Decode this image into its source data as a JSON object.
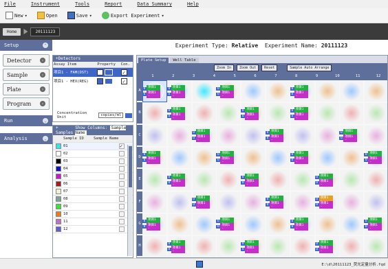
{
  "menu": [
    "File",
    "Instrument",
    "Tools",
    "Report",
    "Data Summary",
    "Help"
  ],
  "toolbar": {
    "new": "New",
    "open": "Open",
    "save": "Save",
    "export": "Export Experiment"
  },
  "breadcrumb": {
    "home": "Home",
    "experiment": "20111123"
  },
  "nav": {
    "setup": "Setup",
    "run": "Run",
    "analysis": "Analysis",
    "setup_items": [
      "Detector",
      "Sample",
      "Plate",
      "Program"
    ]
  },
  "experiment": {
    "label": "Experiment Type:",
    "type": "Relative",
    "name_label": "Experiment Name:",
    "name": "20111123"
  },
  "detectors": {
    "title": "Detectors",
    "headers": [
      "Assay Item",
      "Property",
      "Con."
    ],
    "rows": [
      {
        "item": "项目1 - FAM(DST)",
        "checked": true,
        "selected": true
      },
      {
        "item": "项目1 - HEX(REG)",
        "checked": true,
        "selected": false
      }
    ],
    "conc_label": "Concentration Unit",
    "conc_value": "copies/ml"
  },
  "samples": {
    "title": "Samples",
    "show_cols": "Show Columns:",
    "show_value": "Sample Name",
    "headers": [
      "Sample ID",
      "Sample Name"
    ],
    "rows": [
      {
        "id": "01",
        "color": "#40e0e0"
      },
      {
        "id": "02",
        "color": "#ffffff"
      },
      {
        "id": "03",
        "color": "#000000"
      },
      {
        "id": "04",
        "color": "#1010c0"
      },
      {
        "id": "05",
        "color": "#c020c0"
      },
      {
        "id": "06",
        "color": "#a02020"
      },
      {
        "id": "07",
        "color": "#f0f0d0"
      },
      {
        "id": "08",
        "color": "#80a0a0"
      },
      {
        "id": "09",
        "color": "#40e040"
      },
      {
        "id": "10",
        "color": "#e08020"
      },
      {
        "id": "11",
        "color": "#c070c0"
      },
      {
        "id": "12",
        "color": "#6060d0"
      }
    ]
  },
  "plate": {
    "tabs": [
      "Plate Setup",
      "Well Table"
    ],
    "buttons": [
      "Zoom In",
      "Zoom Out",
      "Reset",
      "Sample Auto Arrange"
    ],
    "cols": [
      "1",
      "2",
      "3",
      "4",
      "5",
      "6",
      "7",
      "8",
      "9",
      "10",
      "11",
      "12"
    ],
    "rows": [
      "A",
      "B",
      "C",
      "D",
      "E",
      "F",
      "G",
      "H"
    ],
    "well_text_1": "项目1 -",
    "well_text_2": "项目1 -"
  },
  "status": {
    "path": "E:\\d\\20111123_荧光定量分析.fqd"
  }
}
